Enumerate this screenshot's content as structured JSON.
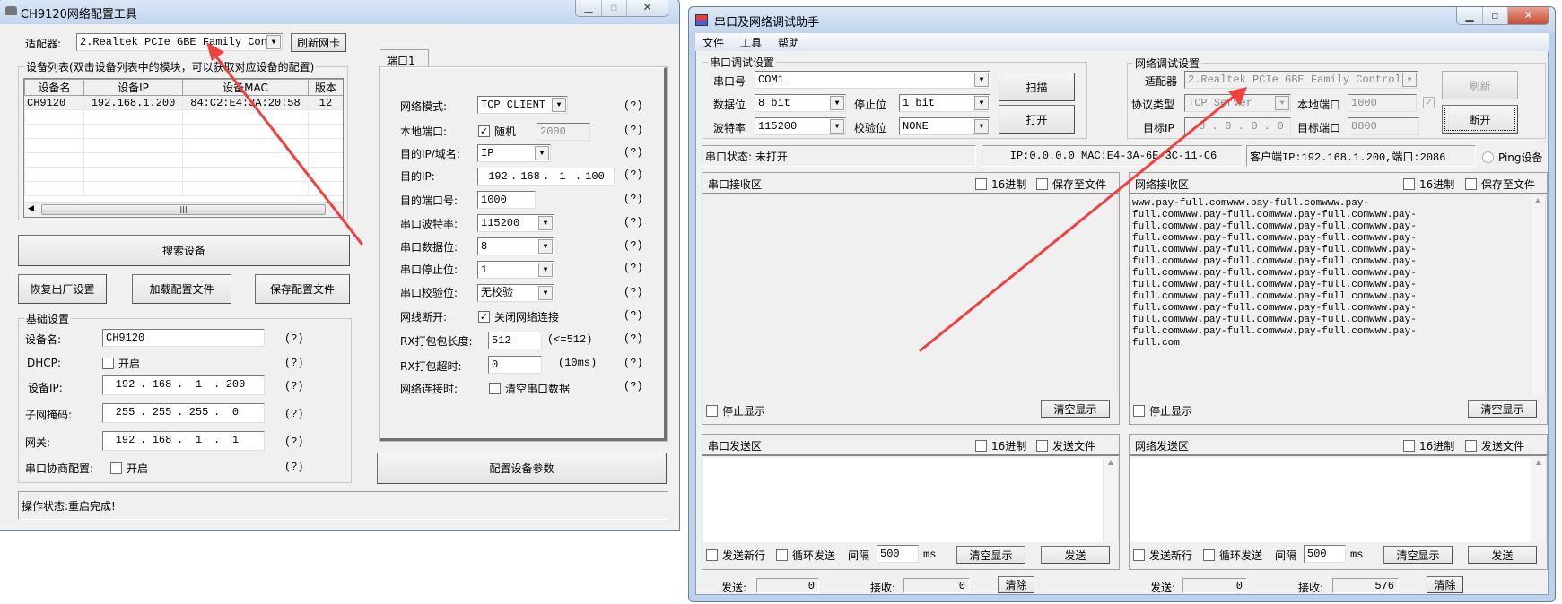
{
  "left_window": {
    "title": "CH9120网络配置工具",
    "adapter_label": "适配器:",
    "adapter_value": "2.Realtek PCIe GBE Family Cont:",
    "refresh_nic": "刷新网卡",
    "device_list_title": "设备列表(双击设备列表中的模块，可以获取对应设备的配置)",
    "columns": [
      "设备名",
      "设备IP",
      "设备MAC",
      "版本"
    ],
    "devices": [
      {
        "name": "CH9120",
        "ip": "192.168.1.200",
        "mac": "84:C2:E4:3A:20:58",
        "version": "12"
      }
    ],
    "search_button": "搜索设备",
    "factory_reset_button": "恢复出厂设置",
    "load_config_button": "加载配置文件",
    "save_config_button": "保存配置文件",
    "basic": {
      "title": "基础设置",
      "device_name_label": "设备名:",
      "device_name": "CH9120",
      "dhcp_label": "DHCP:",
      "dhcp_option": "开启",
      "dhcp_checked": false,
      "device_ip_label": "设备IP:",
      "device_ip": [
        "192",
        "168",
        "1",
        "200"
      ],
      "subnet_label": "子网掩码:",
      "subnet": [
        "255",
        "255",
        "255",
        "0"
      ],
      "gateway_label": "网关:",
      "gateway": [
        "192",
        "168",
        "1",
        "1"
      ],
      "serial_negotiation_label": "串口协商配置:",
      "serial_negotiation_option": "开启",
      "serial_negotiation_checked": false,
      "help": "(?)"
    },
    "port_tab": "端口1",
    "port": {
      "net_mode_label": "网络模式:",
      "net_mode": "TCP CLIENT",
      "local_port_label": "本地端口:",
      "random_label": "随机",
      "random_checked": true,
      "local_port": "2000",
      "dest_type_label": "目的IP/域名:",
      "dest_type": "IP",
      "dest_ip_label": "目的IP:",
      "dest_ip": [
        "192",
        "168",
        "1",
        "100"
      ],
      "dest_port_label": "目的端口号:",
      "dest_port": "1000",
      "baud_label": "串口波特率:",
      "baud": "115200",
      "data_bits_label": "串口数据位:",
      "data_bits": "8",
      "stop_bits_label": "串口停止位:",
      "stop_bits": "1",
      "parity_label": "串口校验位:",
      "parity": "无校验",
      "disconnect_label": "网线断开:",
      "disconnect_option": "关闭网络连接",
      "disconnect_checked": true,
      "rx_len_label": "RX打包包长度:",
      "rx_len": "512",
      "rx_len_hint": "(<=512)",
      "rx_timeout_label": "RX打包超时:",
      "rx_timeout": "0",
      "rx_timeout_hint": "(10ms)",
      "on_connect_label": "网络连接时:",
      "on_connect_option": "清空串口数据",
      "on_connect_checked": false
    },
    "configure_button": "配置设备参数",
    "status": "操作状态:重启完成!"
  },
  "right_window": {
    "title": "串口及网络调试助手",
    "menu": [
      "文件",
      "工具",
      "帮助"
    ],
    "serial": {
      "title": "串口调试设置",
      "port_label": "串口号",
      "port": "COM1",
      "data_bits_label": "数据位",
      "data_bits": "8 bit",
      "stop_bits_label": "停止位",
      "stop_bits": "1 bit",
      "baud_label": "波特率",
      "baud": "115200",
      "parity_label": "校验位",
      "parity": "NONE",
      "scan_button": "扫描",
      "open_button": "打开"
    },
    "network": {
      "title": "网络调试设置",
      "adapter_label": "适配器",
      "adapter": "2.Realtek PCIe GBE Family Controll",
      "protocol_label": "协议类型",
      "protocol": "TCP Server",
      "local_port_label": "本地端口",
      "local_port": "1000",
      "local_port_checked": true,
      "target_ip_label": "目标IP",
      "target_ip": [
        "0",
        "0",
        "0",
        "0"
      ],
      "target_port_label": "目标端口",
      "target_port": "8800",
      "refresh_button": "刷新",
      "disconnect_button": "断开"
    },
    "status_bar": {
      "serial_status": "串口状态: 未打开",
      "ip_mac": "IP:0.0.0.0 MAC:E4-3A-6E-3C-11-C6",
      "client": "客户端IP:192.168.1.200,端口:2086",
      "ping_label": "Ping设备"
    },
    "serial_rx": {
      "title": "串口接收区",
      "hex": "16进制",
      "save": "保存至文件",
      "stop": "停止显示",
      "clear": "清空显示",
      "content": ""
    },
    "net_rx": {
      "title": "网络接收区",
      "hex": "16进制",
      "save": "保存至文件",
      "stop": "停止显示",
      "clear": "清空显示",
      "content": "www.pay-full.comwww.pay-full.comwww.pay-full.comwww.pay-full.comwww.pay-full.comwww.pay-full.comwww.pay-full.comwww.pay-full.comwww.pay-full.comwww.pay-full.comwww.pay-full.comwww.pay-full.comwww.pay-full.comwww.pay-full.comwww.pay-full.comwww.pay-full.comwww.pay-full.comwww.pay-full.comwww.pay-full.comwww.pay-full.comwww.pay-full.comwww.pay-full.comwww.pay-full.comwww.pay-full.comwww.pay-full.comwww.pay-full.comwww.pay-full.comwww.pay-full.comwww.pay-full.comwww.pay-full.comwww.pay-full.comwww.pay-full.comwww.pay-full.comwww.pay-full.comwww.pay-full.comwww.pay-full.com"
    },
    "serial_tx": {
      "title": "串口发送区",
      "hex": "16进制",
      "file": "发送文件",
      "newline": "发送新行",
      "loop": "循环发送",
      "interval_label": "间隔",
      "interval": "500",
      "unit": "ms",
      "clear": "清空显示",
      "send": "发送"
    },
    "net_tx": {
      "title": "网络发送区",
      "hex": "16进制",
      "file": "发送文件",
      "newline": "发送新行",
      "loop": "循环发送",
      "interval_label": "间隔",
      "interval": "500",
      "unit": "ms",
      "clear": "清空显示",
      "send": "发送"
    },
    "serial_counters": {
      "sent_label": "发送:",
      "sent": "0",
      "recv_label": "接收:",
      "recv": "0",
      "clear": "清除"
    },
    "net_counters": {
      "sent_label": "发送:",
      "sent": "0",
      "recv_label": "接收:",
      "recv": "576",
      "clear": "清除"
    }
  },
  "annotation_color": "#f04040"
}
